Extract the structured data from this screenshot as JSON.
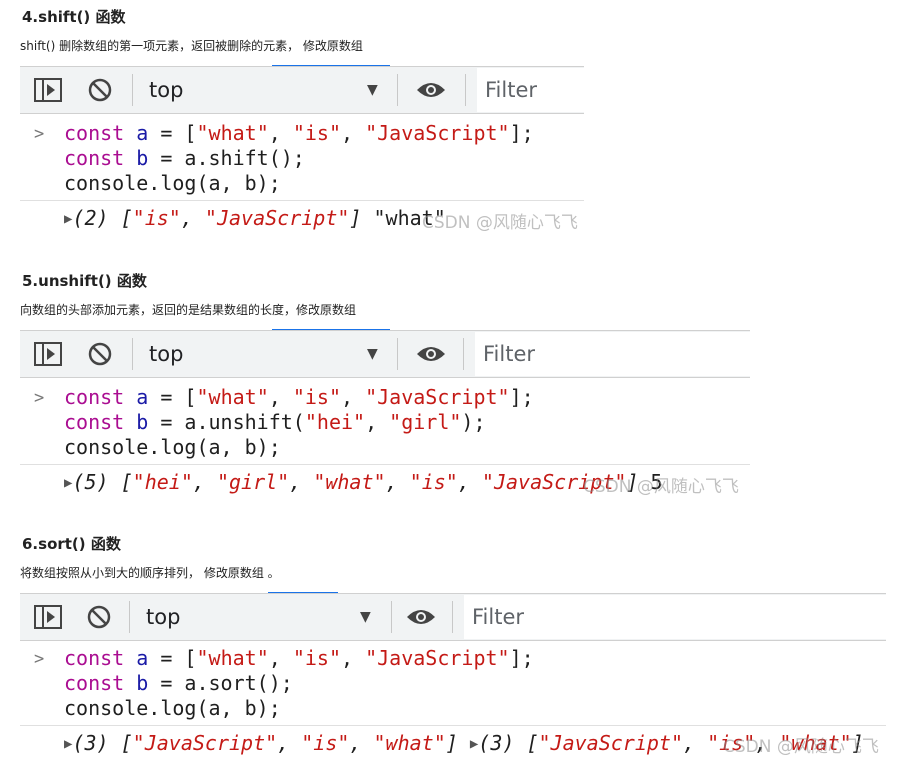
{
  "sections": [
    {
      "title": "4.shift() 函数",
      "description": "shift() 删除数组的第一项元素，返回被删除的元素， 修改原数组",
      "context": "top",
      "filter_placeholder": "Filter",
      "code": {
        "line1": {
          "kw": "const",
          "var": "a",
          "op": " = [",
          "s1": "\"what\"",
          "s2": "\"is\"",
          "s3": "\"JavaScript\"",
          "end": "];"
        },
        "line2": {
          "kw": "const",
          "var": "b",
          "rest": " = a.shift();"
        },
        "line3": "console.log(a, b);"
      },
      "output": {
        "count": "(2)",
        "open": " [",
        "items": [
          "\"is\"",
          "\"JavaScript\""
        ],
        "close": "]",
        "extra": "\"what\""
      },
      "watermark": "CSDN @风随心飞飞"
    },
    {
      "title": "5.unshift() 函数",
      "description": "向数组的头部添加元素，返回的是结果数组的长度，修改原数组",
      "context": "top",
      "filter_placeholder": "Filter",
      "code": {
        "line1": {
          "kw": "const",
          "var": "a",
          "op": " = [",
          "s1": "\"what\"",
          "s2": "\"is\"",
          "s3": "\"JavaScript\"",
          "end": "];"
        },
        "line2": {
          "kw": "const",
          "var": "b",
          "rest1": " = a.unshift(",
          "s1": "\"hei\"",
          "s2": "\"girl\"",
          "rest2": ");"
        },
        "line3": "console.log(a, b);"
      },
      "output": {
        "count": "(5)",
        "open": " [",
        "items": [
          "\"hei\"",
          "\"girl\"",
          "\"what\"",
          "\"is\"",
          "\"JavaScript\""
        ],
        "close": "]",
        "extra": "5"
      },
      "watermark": "CSDN @风随心飞飞"
    },
    {
      "title": "6.sort() 函数",
      "description": "将数组按照从小到大的顺序排列， 修改原数组 。",
      "context": "top",
      "filter_placeholder": "Filter",
      "code": {
        "line1": {
          "kw": "const",
          "var": "a",
          "op": " = [",
          "s1": "\"what\"",
          "s2": "\"is\"",
          "s3": "\"JavaScript\"",
          "end": "];"
        },
        "line2": {
          "kw": "const",
          "var": "b",
          "rest": " = a.sort();"
        },
        "line3": "console.log(a, b);"
      },
      "output": {
        "first": {
          "count": "(3)",
          "open": " [",
          "items": [
            "\"JavaScript\"",
            "\"is\"",
            "\"what\""
          ],
          "close": "]"
        },
        "second": {
          "count": "(3)",
          "open": " [",
          "items": [
            "\"JavaScript\"",
            "\"is\"",
            "\"what\""
          ],
          "close": "]"
        }
      },
      "watermark": "CSDN @风随心飞飞"
    }
  ]
}
